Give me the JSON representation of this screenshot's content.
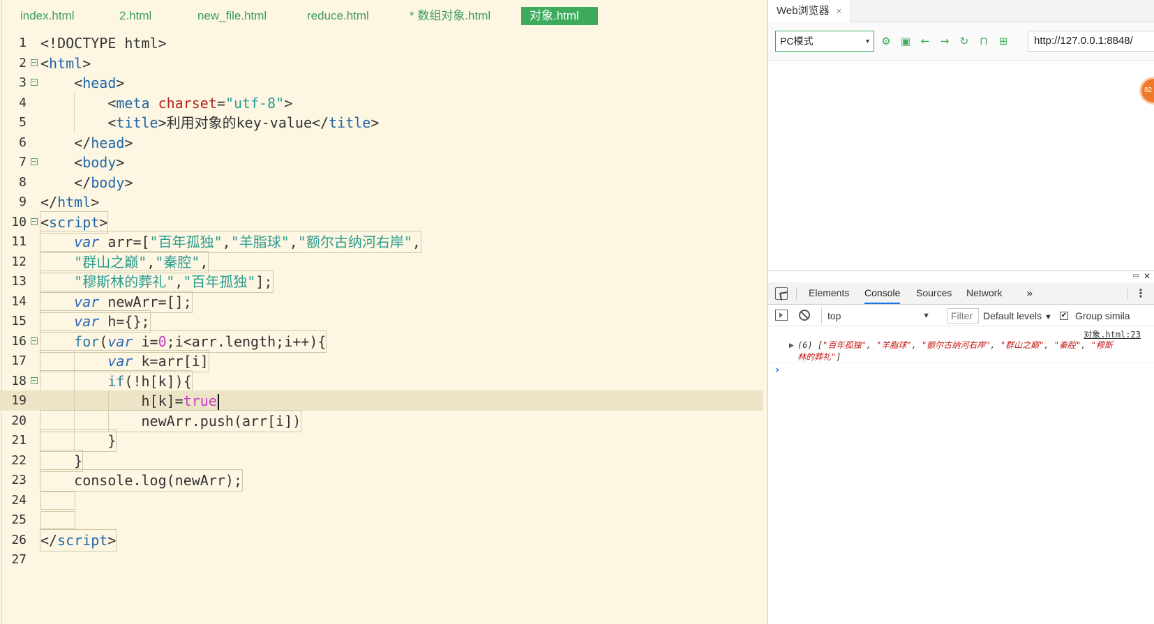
{
  "editor": {
    "tabs": [
      {
        "label": "index.html",
        "active": false
      },
      {
        "label": "2.html",
        "active": false
      },
      {
        "label": "new_file.html",
        "active": false
      },
      {
        "label": "reduce.html",
        "active": false
      },
      {
        "label": "* 数组对象.html",
        "active": false
      },
      {
        "label": "对象.html",
        "active": true
      }
    ],
    "line_numbers": [
      "1",
      "2",
      "3",
      "4",
      "5",
      "6",
      "7",
      "8",
      "9",
      "10",
      "11",
      "12",
      "13",
      "14",
      "15",
      "16",
      "17",
      "18",
      "19",
      "20",
      "21",
      "22",
      "23",
      "24",
      "25",
      "26",
      "27"
    ],
    "code": {
      "l1": "<!DOCTYPE html>",
      "l2_open": "<",
      "l2_tag": "html",
      "l2_close": ">",
      "l3_indent": "    ",
      "l3_open": "<",
      "l3_tag": "head",
      "l3_close": ">",
      "l4_indent": "        ",
      "l4_open": "<",
      "l4_tag": "meta",
      "l4_space": " ",
      "l4_attr": "charset",
      "l4_eq": "=",
      "l4_val": "\"utf-8\"",
      "l4_close": ">",
      "l5_indent": "        ",
      "l5_open": "<",
      "l5_tag": "title",
      "l5_close": ">",
      "l5_text": "利用对象的key-value",
      "l5_end_open": "</",
      "l5_end_tag": "title",
      "l5_end_close": ">",
      "l6_indent": "    ",
      "l6_open": "</",
      "l6_tag": "head",
      "l6_close": ">",
      "l7_indent": "    ",
      "l7_open": "<",
      "l7_tag": "body",
      "l7_close": ">",
      "l8_indent": "    ",
      "l8_open": "</",
      "l8_tag": "body",
      "l8_close": ">",
      "l9_open": "</",
      "l9_tag": "html",
      "l9_close": ">",
      "l10_open": "<",
      "l10_tag": "script",
      "l10_close": ">",
      "l11_kw": "var",
      "l11_rest": " arr=[",
      "l11_s1": "\"百年孤独\"",
      "l11_c1": ",",
      "l11_s2": "\"羊脂球\"",
      "l11_c2": ",",
      "l11_s3": "\"额尔古纳河右岸\"",
      "l11_c3": ",",
      "l12_s1": "\"群山之巅\"",
      "l12_c1": ",",
      "l12_s2": "\"秦腔\"",
      "l12_c2": ",",
      "l13_s1": "\"穆斯林的葬礼\"",
      "l13_c1": ",",
      "l13_s2": "\"百年孤独\"",
      "l13_c2": "];",
      "l14_kw": "var",
      "l14_rest": " newArr=[];",
      "l15_kw": "var",
      "l15_rest": " h={};",
      "l16_for": "for",
      "l16_p": "(",
      "l16_kw": "var",
      "l16_a": " i=",
      "l16_num": "0",
      "l16_b": ";i<arr.length;i++){",
      "l17_kw": "var",
      "l17_rest": " k=arr[i]",
      "l18_if": "if",
      "l18_rest": "(!h[k]){",
      "l19_a": "h[k]=",
      "l19_true": "true",
      "l20": "newArr.push(arr[i])",
      "l21": "}",
      "l22": "}",
      "l23": "console.log(newArr);",
      "l26_open": "</",
      "l26_tag": "script",
      "l26_close": ">"
    }
  },
  "browser": {
    "tab_title": "Web浏览器",
    "tab_close": "×",
    "mode": "PC模式",
    "url": "http://127.0.0.1:8848/",
    "badge": "82",
    "icons": [
      "settings-icon",
      "console-icon",
      "back-icon",
      "forward-icon",
      "refresh-icon",
      "lock-icon",
      "qrcode-icon"
    ]
  },
  "devtools": {
    "undock": "▭",
    "close": "✕",
    "tabs": [
      "Elements",
      "Console",
      "Sources",
      "Network"
    ],
    "active_tab": "Console",
    "more": "»",
    "kebab": "⋮",
    "context": "top",
    "filter_placeholder": "Filter",
    "levels": "Default levels",
    "group_label": "Group simila",
    "group_checked": "✔",
    "log": {
      "source": "对象.html:23",
      "prefix": "(6) [",
      "items": [
        "\"百年孤独\"",
        "\"羊脂球\"",
        "\"额尔古纳河右岸\"",
        "\"群山之巅\"",
        "\"秦腔\"",
        "\"穆斯林的葬礼\""
      ],
      "sep": ", ",
      "suffix": "]"
    },
    "prompt": "›"
  }
}
